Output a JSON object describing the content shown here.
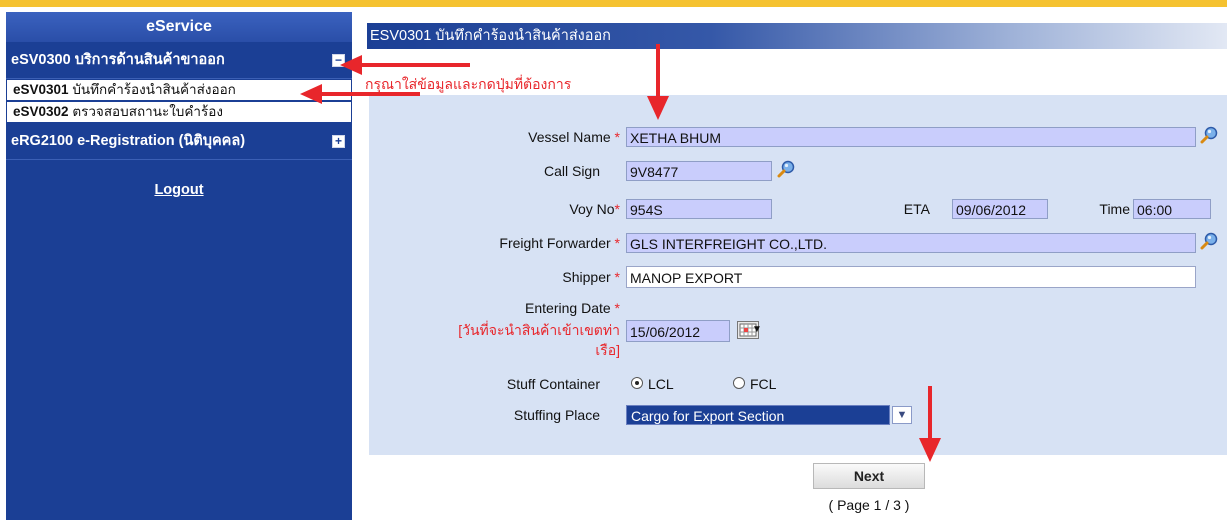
{
  "sidebar": {
    "title": "eService",
    "group1": {
      "label": "eSV0300 บริการด้านสินค้าขาออก",
      "toggle": "−"
    },
    "items": [
      {
        "code": "eSV0301",
        "label": " บันทึกคำร้องนำสินค้าส่งออก"
      },
      {
        "code": "eSV0302",
        "label": " ตรวจสอบสถานะใบคำร้อง"
      }
    ],
    "group2": {
      "label": "eRG2100 e-Registration (นิติบุคคล)",
      "toggle": "+"
    },
    "logout": "Logout"
  },
  "header": {
    "title": "ESV0301 บันทึกคำร้องนำสินค้าส่งออก"
  },
  "instruction": "กรุณาใส่ข้อมูลและกดปุ่มที่ต้องการ",
  "form": {
    "vessel_name": {
      "label": "Vessel Name",
      "req": " *",
      "value": "XETHA BHUM"
    },
    "call_sign": {
      "label": "Call Sign",
      "value": "9V8477"
    },
    "voy_no": {
      "label": "Voy No",
      "req": "*",
      "value": "954S"
    },
    "eta": {
      "label": "ETA",
      "value": "09/06/2012"
    },
    "time": {
      "label": "Time",
      "value": "06:00"
    },
    "freight_forwarder": {
      "label": "Freight Forwarder",
      "req": " *",
      "value": "GLS INTERFREIGHT CO.,LTD."
    },
    "shipper": {
      "label": "Shipper",
      "req": " *",
      "value": "MANOP EXPORT"
    },
    "entering_date": {
      "label": "Entering Date",
      "req": " *",
      "note_line1": "[วันที่จะนำสินค้าเข้าเขตท่า",
      "note_line2": "เรือ]",
      "value": "15/06/2012"
    },
    "stuff_container": {
      "label": "Stuff Container",
      "options": [
        "LCL",
        "FCL"
      ],
      "selected": "LCL"
    },
    "stuffing_place": {
      "label": "Stuffing Place",
      "value": "Cargo for Export Section"
    }
  },
  "buttons": {
    "next": "Next"
  },
  "page_info": "( Page 1 / 3 )",
  "colors": {
    "accent_red": "#e8262b",
    "sidebar_blue": "#1b3f95",
    "field_purple": "#c9cdfc",
    "panel_blue": "#d7e2f4",
    "top_bar": "#f5c230"
  }
}
